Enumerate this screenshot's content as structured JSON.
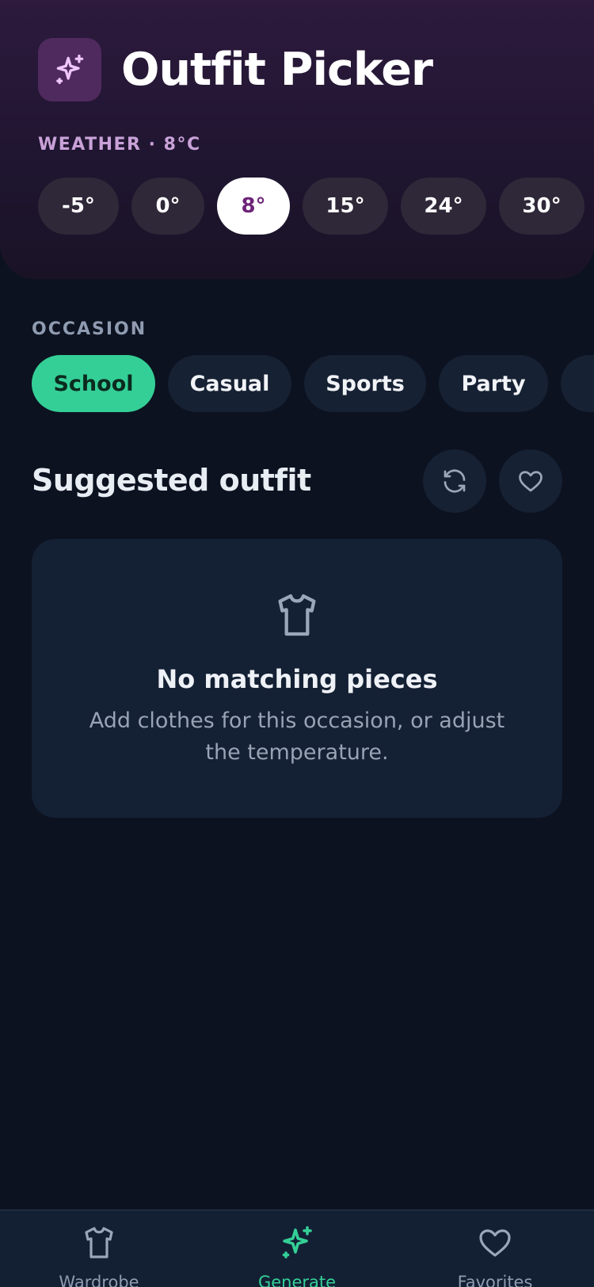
{
  "header": {
    "title": "Outfit Picker",
    "logo_icon": "sparkles-icon",
    "weather_label": "WEATHER · 8°C",
    "temperatures": [
      "-5°",
      "0°",
      "8°",
      "15°",
      "24°",
      "30°"
    ],
    "selected_temperature": "8°"
  },
  "occasion": {
    "label": "OCCASION",
    "options": [
      "School",
      "Casual",
      "Sports",
      "Party"
    ],
    "selected": "School"
  },
  "suggested": {
    "title": "Suggested outfit",
    "refresh_icon": "refresh-icon",
    "favorite_icon": "heart-icon",
    "empty_icon": "shirt-icon",
    "empty_title": "No matching pieces",
    "empty_description": "Add clothes for this occasion, or adjust the temperature."
  },
  "nav": {
    "items": [
      {
        "label": "Wardrobe",
        "icon": "shirt-icon"
      },
      {
        "label": "Generate",
        "icon": "sparkles-icon"
      },
      {
        "label": "Favorites",
        "icon": "heart-icon"
      }
    ],
    "active": "Generate"
  },
  "colors": {
    "accent": "#34cf96",
    "header_bg": "#2d1a3d",
    "page_bg": "#0c1220",
    "selected_temp_text": "#6e2478"
  }
}
